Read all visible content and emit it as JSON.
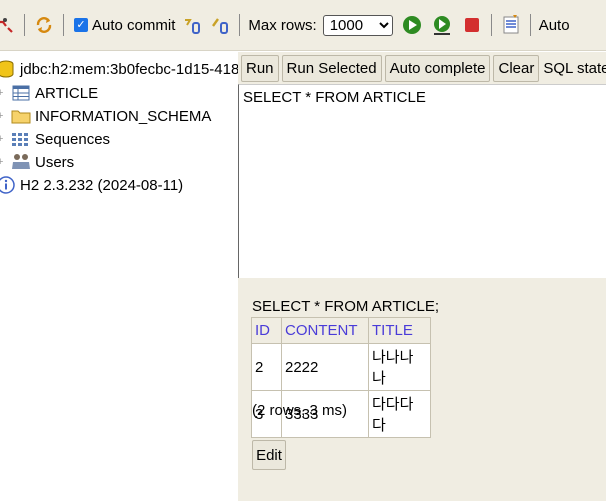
{
  "toolbar": {
    "auto_commit_label": "Auto commit",
    "auto_commit_checked": true,
    "max_rows_label": "Max rows:",
    "max_rows_value": "1000",
    "auto_label": "Auto"
  },
  "tree": {
    "connection": "jdbc:h2:mem:3b0fecbc-1d15-418",
    "items": [
      {
        "label": "ARTICLE",
        "icon": "table-icon"
      },
      {
        "label": "INFORMATION_SCHEMA",
        "icon": "folder-icon"
      },
      {
        "label": "Sequences",
        "icon": "sequences-icon"
      },
      {
        "label": "Users",
        "icon": "users-icon"
      }
    ],
    "version": "H2 2.3.232 (2024-08-11)"
  },
  "query_bar": {
    "run": "Run",
    "run_selected": "Run Selected",
    "auto_complete": "Auto complete",
    "clear": "Clear",
    "sql_statement_label": "SQL state"
  },
  "editor": {
    "sql": "SELECT * FROM ARTICLE"
  },
  "result": {
    "statement": "SELECT * FROM ARTICLE;",
    "columns": [
      "ID",
      "CONTENT",
      "TITLE"
    ],
    "rows": [
      [
        "2",
        "2222",
        "나나나나"
      ],
      [
        "3",
        "3333",
        "다다다다"
      ]
    ],
    "info": "(2 rows, 3 ms)",
    "edit": "Edit"
  },
  "colors": {
    "panel_bg": "#f0ede2",
    "column_header": "#4a3cd8",
    "run_green": "#2e8b22",
    "stop_red": "#d32f2f"
  }
}
